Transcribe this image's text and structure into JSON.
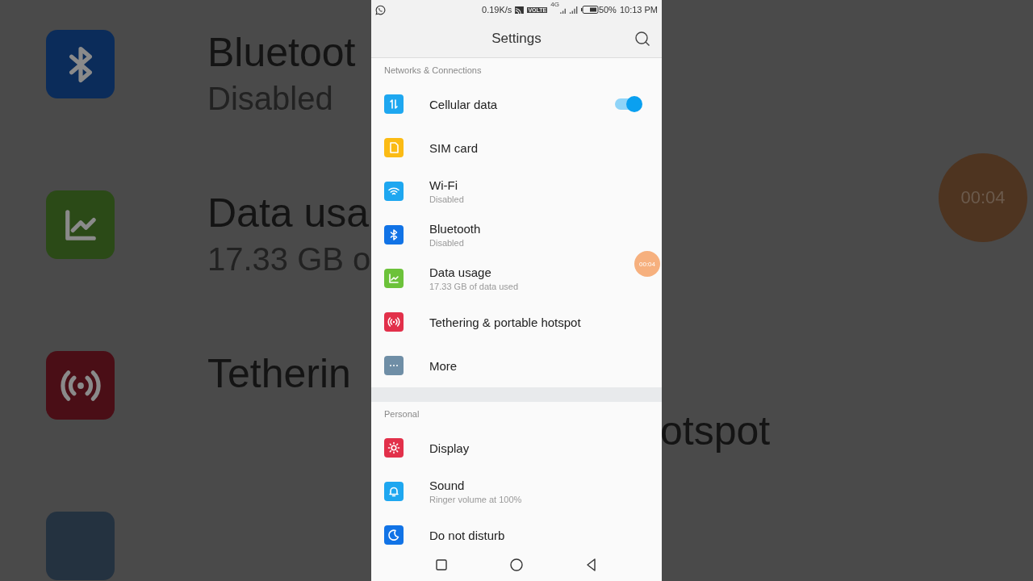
{
  "backdrop": {
    "left_rows": [
      {
        "color": "#0b2c5a",
        "title": "Bluetoot",
        "subtitle": "Disabled"
      },
      {
        "color": "#2b4a17",
        "title": "Data usa",
        "subtitle": "17.33 GB o"
      },
      {
        "color": "#4a0e16",
        "title": "Tetherin"
      },
      {
        "color": "#243240"
      }
    ],
    "right_text": "otspot",
    "bubble_time": "00:04"
  },
  "status_bar": {
    "network_speed": "0.19K/s",
    "volte": "VOLTE",
    "network_type": "4G",
    "battery": "50%",
    "time": "10:13 PM"
  },
  "header": {
    "title": "Settings"
  },
  "sections": [
    {
      "title": "Networks & Connections",
      "items": [
        {
          "color": "#1ea7f0",
          "title": "Cellular data",
          "kind": "switch",
          "on": true
        },
        {
          "color": "#fbbb14",
          "title": "SIM card",
          "kind": "plain"
        },
        {
          "color": "#1ea7f0",
          "title": "Wi-Fi",
          "subtitle": "Disabled",
          "kind": "plain"
        },
        {
          "color": "#1173e6",
          "title": "Bluetooth",
          "subtitle": "Disabled",
          "kind": "plain"
        },
        {
          "color": "#6cc23a",
          "title": "Data usage",
          "subtitle": "17.33 GB of data used",
          "kind": "plain"
        },
        {
          "color": "#e2304a",
          "title": "Tethering & portable hotspot",
          "kind": "plain"
        },
        {
          "color": "#6f8ea6",
          "title": "More",
          "kind": "plain"
        }
      ]
    },
    {
      "title": "Personal",
      "items": [
        {
          "color": "#e2304a",
          "title": "Display",
          "kind": "plain"
        },
        {
          "color": "#1ea7f0",
          "title": "Sound",
          "subtitle": "Ringer volume at 100%",
          "kind": "plain"
        },
        {
          "color": "#1173e6",
          "title": "Do not disturb",
          "kind": "plain"
        }
      ]
    }
  ],
  "recorder_bubble": {
    "time": "00:04"
  }
}
